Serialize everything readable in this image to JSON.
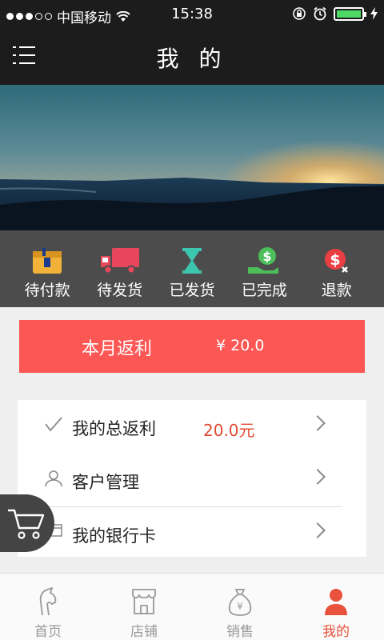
{
  "status_bar": {
    "carrier": "中国移动",
    "time": "15:38"
  },
  "header": {
    "title": "我 的"
  },
  "orders": [
    {
      "label": "待付款",
      "icon": "wallet-icon"
    },
    {
      "label": "待发货",
      "icon": "truck-icon"
    },
    {
      "label": "已发货",
      "icon": "hourglass-icon"
    },
    {
      "label": "已完成",
      "icon": "money-hand-icon"
    },
    {
      "label": "退款",
      "icon": "refund-icon"
    }
  ],
  "rebate": {
    "label": "本月返利",
    "amount": "¥ 20.0"
  },
  "menu_list": [
    {
      "label": "我的总返利",
      "value": "20.0元",
      "icon": "check-icon"
    },
    {
      "label": "客户管理",
      "icon": "user-icon"
    },
    {
      "label": "我的银行卡",
      "icon": "card-icon"
    }
  ],
  "tabbar": {
    "active": 3,
    "tabs": [
      {
        "label": "首页",
        "icon": "horse-icon"
      },
      {
        "label": "店铺",
        "icon": "shop-icon"
      },
      {
        "label": "销售",
        "icon": "money-bag-icon"
      },
      {
        "label": "我的",
        "icon": "user-icon"
      }
    ]
  },
  "colors": {
    "nav_bg": "#1c1c1c",
    "order_bar_bg": "#4c4c4c",
    "accent": "#fc5754",
    "value_red": "#e14b33",
    "battery": "#4cd964"
  }
}
